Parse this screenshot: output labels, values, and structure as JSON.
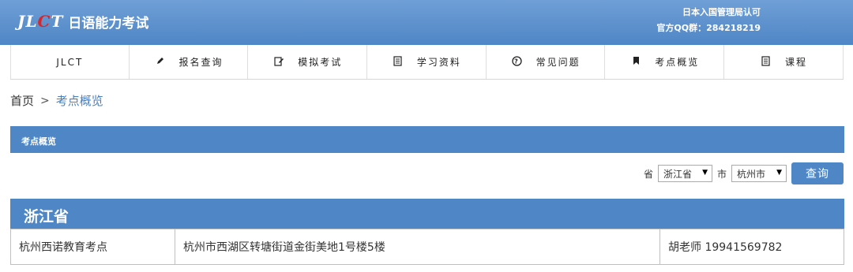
{
  "header": {
    "logo_mark": [
      "JL",
      "C",
      "T"
    ],
    "logo_text": "日语能力考试",
    "right_line1": "日本入国管理局认可",
    "right_line2": "官方QQ群：284218219"
  },
  "nav": {
    "items": [
      {
        "label": "JLCT",
        "icon": ""
      },
      {
        "label": "报名查询",
        "icon": "pencil-icon"
      },
      {
        "label": "模拟考试",
        "icon": "edit-icon"
      },
      {
        "label": "学习资料",
        "icon": "document-icon"
      },
      {
        "label": "常见问题",
        "icon": "question-circle-icon"
      },
      {
        "label": "考点概览",
        "icon": "bookmark-icon"
      },
      {
        "label": "课程",
        "icon": "document-icon"
      }
    ]
  },
  "breadcrumb": {
    "home": "首页",
    "separator": ">",
    "current": "考点概览"
  },
  "section": {
    "title": "考点概览"
  },
  "filter": {
    "province_label": "省",
    "province_value": "浙江省",
    "city_label": "市",
    "city_value": "杭州市",
    "query_label": "查询"
  },
  "results": {
    "province": "浙江省",
    "rows": [
      {
        "name": "杭州西诺教育考点",
        "address": "杭州市西湖区转塘街道金街美地1号楼5楼",
        "contact": "胡老师  19941569782"
      }
    ]
  },
  "colors": {
    "primary": "#4f86c6",
    "logo_red": "#d8262b"
  }
}
